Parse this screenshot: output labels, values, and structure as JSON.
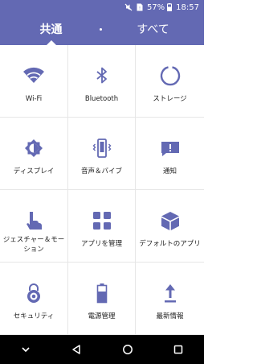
{
  "status_bar": {
    "battery_percent": "57%",
    "time": "18:57",
    "icons": [
      "mute-icon",
      "sim-icon",
      "battery-icon"
    ]
  },
  "tabs": [
    {
      "label": "共通",
      "selected": true
    },
    {
      "label": "すべて",
      "selected": false
    }
  ],
  "colors": {
    "accent": "#6369b3",
    "icon": "#6369b3",
    "navbar": "#000000"
  },
  "grid": [
    {
      "label": "Wi-Fi",
      "icon": "wifi-icon"
    },
    {
      "label": "Bluetooth",
      "icon": "bluetooth-icon"
    },
    {
      "label": "ストレージ",
      "icon": "storage-ring-icon"
    },
    {
      "label": "ディスプレイ",
      "icon": "brightness-icon"
    },
    {
      "label": "音声＆バイブ",
      "icon": "vibrate-icon"
    },
    {
      "label": "通知",
      "icon": "notification-icon"
    },
    {
      "label": "ジェスチャー＆モーション",
      "icon": "gesture-hand-icon"
    },
    {
      "label": "アプリを管理",
      "icon": "apps-grid-icon"
    },
    {
      "label": "デフォルトのアプリ",
      "icon": "default-app-cube-icon"
    },
    {
      "label": "セキュリティ",
      "icon": "lock-icon"
    },
    {
      "label": "電源管理",
      "icon": "battery-power-icon"
    },
    {
      "label": "最新情報",
      "icon": "update-arrow-icon"
    }
  ],
  "navbar": [
    "collapse-icon",
    "back-icon",
    "home-icon",
    "recents-icon"
  ]
}
